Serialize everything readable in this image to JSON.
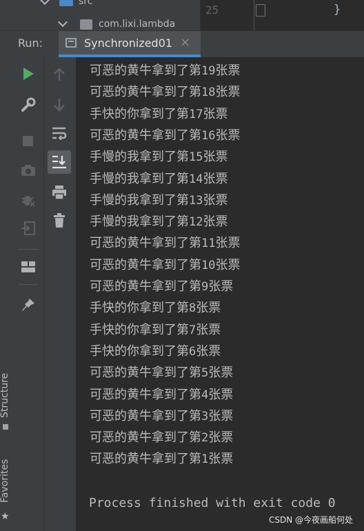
{
  "project_tree": {
    "src_label": "src",
    "package_label": "com.lixi.lambda"
  },
  "editor": {
    "line_number": "25",
    "brace": "}"
  },
  "run": {
    "label": "Run:",
    "tab_title": "Synchronized01",
    "close_glyph": "×"
  },
  "side": {
    "structure_label": "Structure",
    "favorites_label": "Favorites"
  },
  "console": {
    "lines": [
      {
        "prefix": "可恶的黄牛拿到了第",
        "num": "19",
        "suffix": "张票"
      },
      {
        "prefix": "可恶的黄牛拿到了第",
        "num": "18",
        "suffix": "张票"
      },
      {
        "prefix": "手快的你拿到了第",
        "num": "17",
        "suffix": "张票"
      },
      {
        "prefix": "可恶的黄牛拿到了第",
        "num": "16",
        "suffix": "张票"
      },
      {
        "prefix": "手慢的我拿到了第",
        "num": "15",
        "suffix": "张票"
      },
      {
        "prefix": "手慢的我拿到了第",
        "num": "14",
        "suffix": "张票"
      },
      {
        "prefix": "手慢的我拿到了第",
        "num": "13",
        "suffix": "张票"
      },
      {
        "prefix": "手慢的我拿到了第",
        "num": "12",
        "suffix": "张票"
      },
      {
        "prefix": "可恶的黄牛拿到了第",
        "num": "11",
        "suffix": "张票"
      },
      {
        "prefix": "可恶的黄牛拿到了第",
        "num": "10",
        "suffix": "张票"
      },
      {
        "prefix": "可恶的黄牛拿到了第",
        "num": "9",
        "suffix": "张票"
      },
      {
        "prefix": "手快的你拿到了第",
        "num": "8",
        "suffix": "张票"
      },
      {
        "prefix": "手快的你拿到了第",
        "num": "7",
        "suffix": "张票"
      },
      {
        "prefix": "手快的你拿到了第",
        "num": "6",
        "suffix": "张票"
      },
      {
        "prefix": "可恶的黄牛拿到了第",
        "num": "5",
        "suffix": "张票"
      },
      {
        "prefix": "可恶的黄牛拿到了第",
        "num": "4",
        "suffix": "张票"
      },
      {
        "prefix": "可恶的黄牛拿到了第",
        "num": "3",
        "suffix": "张票"
      },
      {
        "prefix": "可恶的黄牛拿到了第",
        "num": "2",
        "suffix": "张票"
      },
      {
        "prefix": "可恶的黄牛拿到了第",
        "num": "1",
        "suffix": "张票"
      }
    ],
    "process_message": "Process finished with exit code 0"
  },
  "watermark": "CSDN @今夜画船何处",
  "icons": {
    "run": "play-icon",
    "tool": "wrench-icon",
    "stop": "stop-icon",
    "dump": "camera-icon",
    "debug": "bug-icon",
    "exit": "exit-icon",
    "layout": "layout-icon",
    "pin": "pin-icon",
    "up": "arrow-up-icon",
    "down": "arrow-down-icon",
    "wrap": "soft-wrap-icon",
    "scroll_end": "scroll-to-end-icon",
    "print": "print-icon",
    "trash": "trash-icon"
  },
  "colors": {
    "run_green": "#59a869",
    "accent_blue": "#4a88c7",
    "console_bg": "#2b2b2b",
    "panel_bg": "#3c3f41",
    "text": "#bbbbbb"
  }
}
